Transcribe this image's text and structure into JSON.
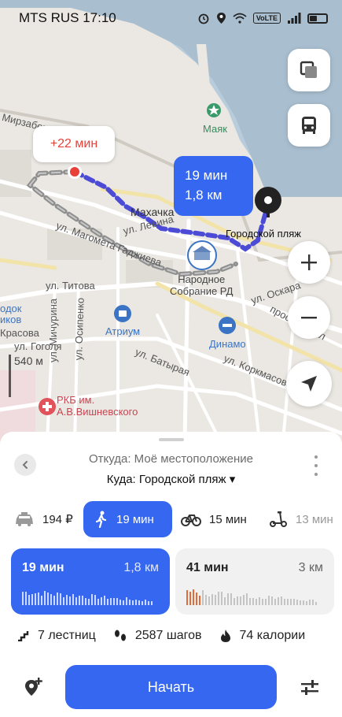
{
  "status_bar": {
    "carrier_time": "MTS RUS 17:10",
    "volte": "VoLTE"
  },
  "map": {
    "streets": {
      "mirzabekova": "Мирзабек",
      "magometa": "ул. Магомета Гаджиева",
      "levina": "ул. Левина",
      "titova": "ул. Титова",
      "michurina": "ул. Мичурина",
      "osipenko": "ул. Осипенко",
      "gogolya": "ул. Гоголя",
      "krasova": "Красова",
      "batiraya": "ул. Батырая",
      "korkmasova": "ул. Коркмасова",
      "oskara": "ул. Оскара",
      "rasul": "просп. Расул",
      "godok": "одок",
      "nikov": "иков"
    },
    "places": {
      "mayak": "Маяк",
      "makhachkala": "Махачка",
      "destination": "Городской пляж",
      "assembly": "Народное\nСобрание РД",
      "atrium": "Атриум",
      "dynamo": "Динамо",
      "hospital": "РКБ им.\nА.В.Вишневского"
    },
    "scale": "540 м",
    "delay_bubble": "+22 мин",
    "route_bubble": {
      "time": "19 мин",
      "distance": "1,8 км"
    },
    "accent": "#3567f0",
    "alert_color": "#e8413a"
  },
  "sheet": {
    "from": "Откуда: Моё местоположение",
    "to": "Куда: Городской пляж ▾",
    "modes": [
      {
        "icon": "taxi-icon",
        "label": "194 ₽"
      },
      {
        "icon": "walk-icon",
        "label": "19 мин",
        "active": true
      },
      {
        "icon": "bicycle-icon",
        "label": "15 мин"
      },
      {
        "icon": "scooter-icon",
        "label": "13 мин"
      }
    ],
    "routes": [
      {
        "time": "19 мин",
        "distance": "1,8 км",
        "selected": true
      },
      {
        "time": "41 мин",
        "distance": "3 км",
        "selected": false
      }
    ],
    "stats": {
      "stairs": "7 лестниц",
      "steps": "2587 шагов",
      "calories": "74 калории"
    },
    "start_button": "Начать"
  }
}
